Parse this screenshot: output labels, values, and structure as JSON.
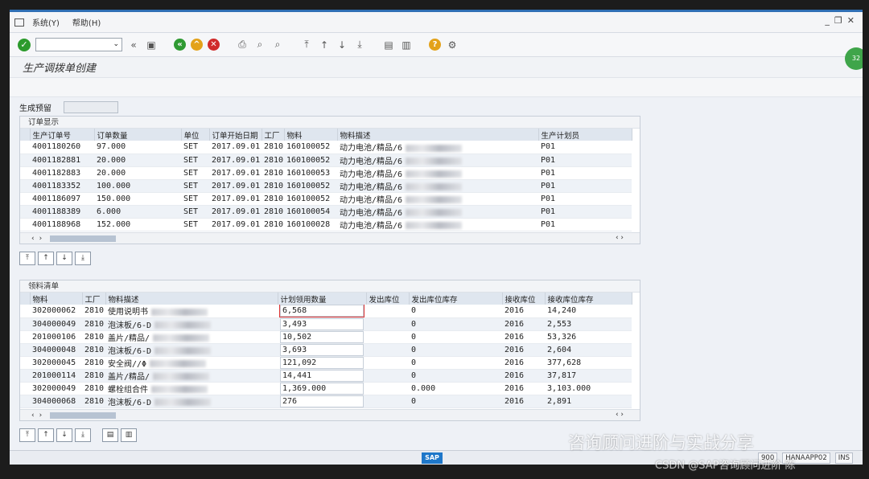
{
  "menu": [
    "系统(Y)",
    "帮助(H)"
  ],
  "toolbar": {
    "command_value": ""
  },
  "title": "生产调拨单创建",
  "field_label": "生成预留",
  "orders_panel": {
    "title": "订单显示",
    "columns": [
      "生产订单号",
      "订单数量",
      "单位",
      "订单开始日期",
      "工厂",
      "物料",
      "物料描述",
      "生产计划员"
    ],
    "rows": [
      [
        "4001180260",
        "97.000",
        "SET",
        "2017.09.01",
        "2810",
        "160100052",
        "动力电池/精品/6",
        "P01"
      ],
      [
        "4001182881",
        "20.000",
        "SET",
        "2017.09.01",
        "2810",
        "160100052",
        "动力电池/精品/6",
        "P01"
      ],
      [
        "4001182883",
        "20.000",
        "SET",
        "2017.09.01",
        "2810",
        "160100053",
        "动力电池/精品/6",
        "P01"
      ],
      [
        "4001183352",
        "100.000",
        "SET",
        "2017.09.01",
        "2810",
        "160100052",
        "动力电池/精品/6",
        "P01"
      ],
      [
        "4001186097",
        "150.000",
        "SET",
        "2017.09.01",
        "2810",
        "160100052",
        "动力电池/精品/6",
        "P01"
      ],
      [
        "4001188389",
        "6.000",
        "SET",
        "2017.09.01",
        "2810",
        "160100054",
        "动力电池/精品/6",
        "P01"
      ],
      [
        "4001188968",
        "152.000",
        "SET",
        "2017.09.01",
        "2810",
        "160100028",
        "动力电池/精品/6",
        "P01"
      ]
    ]
  },
  "materials_panel": {
    "title": "领料清单",
    "columns": [
      "物料",
      "工厂",
      "物料描述",
      "计划领用数量",
      "发出库位",
      "发出库位库存",
      "接收库位",
      "接收库位库存"
    ],
    "rows": [
      [
        "302000062",
        "2810",
        "使用说明书",
        "6,568",
        "",
        "0",
        "2016",
        "14,240"
      ],
      [
        "304000049",
        "2810",
        "泡沫板/6-D",
        "3,493",
        "",
        "0",
        "2016",
        "2,553"
      ],
      [
        "201000106",
        "2810",
        "盖片/精品/",
        "10,502",
        "",
        "0",
        "2016",
        "53,326"
      ],
      [
        "304000048",
        "2810",
        "泡沫板/6-D",
        "3,693",
        "",
        "0",
        "2016",
        "2,604"
      ],
      [
        "302000045",
        "2810",
        "安全阀//Φ",
        "121,092",
        "",
        "0",
        "2016",
        "377,628"
      ],
      [
        "201000114",
        "2810",
        "盖片/精品/",
        "14,441",
        "",
        "0",
        "2016",
        "37,817"
      ],
      [
        "302000049",
        "2810",
        "螺栓组合件",
        "1,369.000",
        "",
        "0.000",
        "2016",
        "3,103.000"
      ],
      [
        "304000068",
        "2810",
        "泡沫板/6-D",
        "276",
        "",
        "0",
        "2016",
        "2,891"
      ]
    ]
  },
  "status": {
    "client": "900",
    "server": "HANAAPP02",
    "mode": "INS"
  },
  "badge": "32",
  "watermarks": [
    "咨询顾问进阶与实战分享",
    "CSDN @SAP咨询顾问进阶 陈"
  ]
}
